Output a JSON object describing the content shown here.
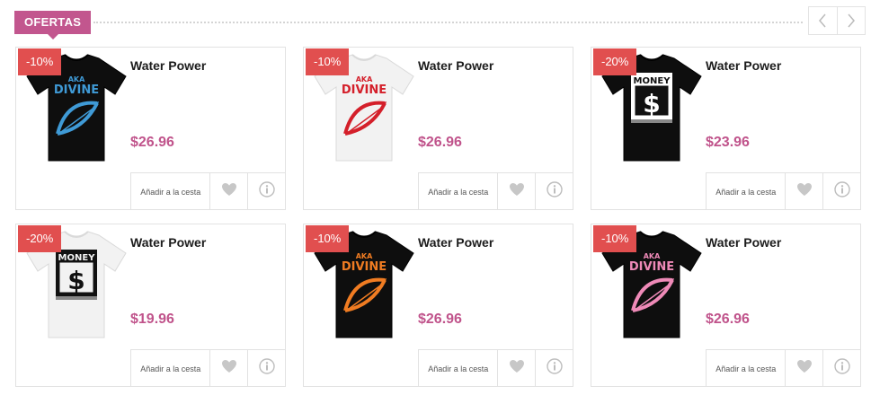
{
  "section": {
    "title": "OFERTAS"
  },
  "colors": {
    "accent": "#c2568e",
    "badge": "#e14f4f",
    "price": "#c0538b"
  },
  "nav": {
    "prev_icon": "chevron-left-icon",
    "next_icon": "chevron-right-icon"
  },
  "products": [
    {
      "discount": "-10%",
      "name": "Water Power",
      "price": "$26.96",
      "add_label": "Añadir a la cesta",
      "shirt": "black",
      "print": "divine",
      "print_color": "#3f9ad6"
    },
    {
      "discount": "-10%",
      "name": "Water Power",
      "price": "$26.96",
      "add_label": "Añadir a la cesta",
      "shirt": "white",
      "print": "divine",
      "print_color": "#d41f2a"
    },
    {
      "discount": "-20%",
      "name": "Water Power",
      "price": "$23.96",
      "add_label": "Añadir a la cesta",
      "shirt": "black",
      "print": "money",
      "print_color": "#ffffff"
    },
    {
      "discount": "-20%",
      "name": "Water Power",
      "price": "$19.96",
      "add_label": "Añadir a la cesta",
      "shirt": "white",
      "print": "money",
      "print_color": "#111111"
    },
    {
      "discount": "-10%",
      "name": "Water Power",
      "price": "$26.96",
      "add_label": "Añadir a la cesta",
      "shirt": "black",
      "print": "divine",
      "print_color": "#f07c22"
    },
    {
      "discount": "-10%",
      "name": "Water Power",
      "price": "$26.96",
      "add_label": "Añadir a la cesta",
      "shirt": "black",
      "print": "divine",
      "print_color": "#ef8ab8"
    }
  ]
}
